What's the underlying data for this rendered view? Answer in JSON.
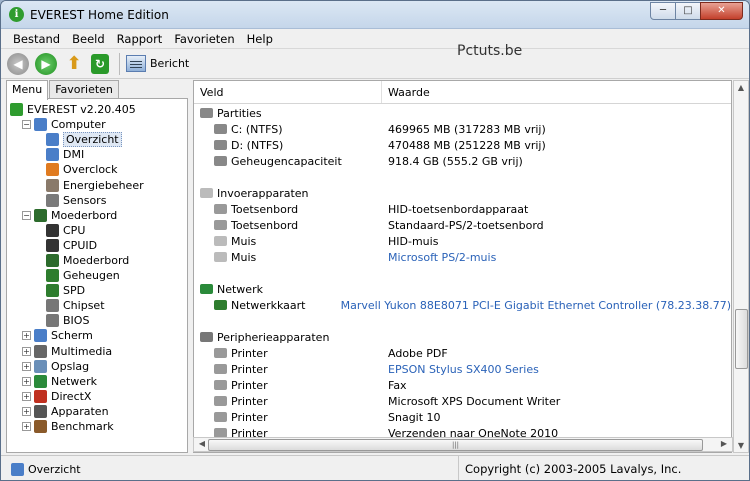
{
  "window": {
    "title": "EVEREST Home Edition",
    "min": "─",
    "max": "□",
    "close": "✕"
  },
  "menu": [
    "Bestand",
    "Beeld",
    "Rapport",
    "Favorieten",
    "Help"
  ],
  "toolbar": {
    "report_label": "Bericht",
    "watermark": "Pctuts.be"
  },
  "left_tabs": [
    "Menu",
    "Favorieten"
  ],
  "tree": [
    {
      "indent": 0,
      "exp": "",
      "label": "EVEREST v2.20.405",
      "icon": "info-icon",
      "color": "#2f9c2f"
    },
    {
      "indent": 1,
      "exp": "−",
      "label": "Computer",
      "icon": "computer-icon",
      "color": "#4a7ec8"
    },
    {
      "indent": 2,
      "exp": "",
      "label": "Overzicht",
      "icon": "computer-icon",
      "color": "#4a7ec8",
      "selected": true
    },
    {
      "indent": 2,
      "exp": "",
      "label": "DMI",
      "icon": "computer-icon",
      "color": "#4a7ec8"
    },
    {
      "indent": 2,
      "exp": "",
      "label": "Overclock",
      "icon": "fire-icon",
      "color": "#e07b20"
    },
    {
      "indent": 2,
      "exp": "",
      "label": "Energiebeheer",
      "icon": "power-icon",
      "color": "#8a7a6a"
    },
    {
      "indent": 2,
      "exp": "",
      "label": "Sensors",
      "icon": "sensor-icon",
      "color": "#7a7a7a"
    },
    {
      "indent": 1,
      "exp": "−",
      "label": "Moederbord",
      "icon": "motherboard-icon",
      "color": "#2c6b2c"
    },
    {
      "indent": 2,
      "exp": "",
      "label": "CPU",
      "icon": "cpu-icon",
      "color": "#333"
    },
    {
      "indent": 2,
      "exp": "",
      "label": "CPUID",
      "icon": "cpu-icon",
      "color": "#333"
    },
    {
      "indent": 2,
      "exp": "",
      "label": "Moederbord",
      "icon": "motherboard-icon",
      "color": "#2c6b2c"
    },
    {
      "indent": 2,
      "exp": "",
      "label": "Geheugen",
      "icon": "memory-icon",
      "color": "#2e7d2e"
    },
    {
      "indent": 2,
      "exp": "",
      "label": "SPD",
      "icon": "memory-icon",
      "color": "#2e7d2e"
    },
    {
      "indent": 2,
      "exp": "",
      "label": "Chipset",
      "icon": "chip-icon",
      "color": "#777"
    },
    {
      "indent": 2,
      "exp": "",
      "label": "BIOS",
      "icon": "chip-icon",
      "color": "#777"
    },
    {
      "indent": 1,
      "exp": "+",
      "label": "Scherm",
      "icon": "monitor-icon",
      "color": "#4a7ec8"
    },
    {
      "indent": 1,
      "exp": "+",
      "label": "Multimedia",
      "icon": "multimedia-icon",
      "color": "#666"
    },
    {
      "indent": 1,
      "exp": "+",
      "label": "Opslag",
      "icon": "storage-icon",
      "color": "#6a8fb8"
    },
    {
      "indent": 1,
      "exp": "+",
      "label": "Netwerk",
      "icon": "network-icon",
      "color": "#2a8a3a"
    },
    {
      "indent": 1,
      "exp": "+",
      "label": "DirectX",
      "icon": "directx-icon",
      "color": "#c03020"
    },
    {
      "indent": 1,
      "exp": "+",
      "label": "Apparaten",
      "icon": "devices-icon",
      "color": "#555"
    },
    {
      "indent": 1,
      "exp": "+",
      "label": "Benchmark",
      "icon": "hourglass-icon",
      "color": "#8a5a2a"
    }
  ],
  "columns": {
    "field": "Veld",
    "value": "Waarde"
  },
  "rows": [
    {
      "f": "Partities",
      "v": "",
      "cat": true,
      "icon": "drive-icon",
      "color": "#888"
    },
    {
      "f": "C: (NTFS)",
      "v": "469965 MB (317283 MB vrij)",
      "icon": "drive-icon",
      "color": "#888"
    },
    {
      "f": "D: (NTFS)",
      "v": "470488 MB (251228 MB vrij)",
      "icon": "drive-icon",
      "color": "#888"
    },
    {
      "f": "Geheugencapaciteit",
      "v": "918.4 GB (555.2 GB vrij)",
      "icon": "drive-icon",
      "color": "#888"
    },
    {
      "f": "",
      "v": ""
    },
    {
      "f": "Invoerapparaten",
      "v": "",
      "cat": true,
      "icon": "mouse-icon",
      "color": "#bbb"
    },
    {
      "f": "Toetsenbord",
      "v": "HID-toetsenbordapparaat",
      "icon": "keyboard-icon",
      "color": "#999"
    },
    {
      "f": "Toetsenbord",
      "v": "Standaard-PS/2-toetsenbord",
      "icon": "keyboard-icon",
      "color": "#999"
    },
    {
      "f": "Muis",
      "v": "HID-muis",
      "icon": "mouse-icon",
      "color": "#bbb"
    },
    {
      "f": "Muis",
      "v": "Microsoft PS/2-muis",
      "link": true,
      "icon": "mouse-icon",
      "color": "#bbb"
    },
    {
      "f": "",
      "v": ""
    },
    {
      "f": "Netwerk",
      "v": "",
      "cat": true,
      "icon": "network-icon",
      "color": "#2a8a3a"
    },
    {
      "f": "Netwerkkaart",
      "v": "Marvell Yukon 88E8071 PCI-E Gigabit Ethernet Controller  (78.23.38.77)",
      "link": true,
      "icon": "network-card-icon",
      "color": "#2e7d2e"
    },
    {
      "f": "",
      "v": ""
    },
    {
      "f": "Peripherieapparaten",
      "v": "",
      "cat": true,
      "icon": "devices-icon",
      "color": "#777"
    },
    {
      "f": "Printer",
      "v": "Adobe PDF",
      "icon": "printer-icon",
      "color": "#999"
    },
    {
      "f": "Printer",
      "v": "EPSON Stylus SX400 Series",
      "link": true,
      "icon": "printer-icon",
      "color": "#999"
    },
    {
      "f": "Printer",
      "v": "Fax",
      "icon": "printer-icon",
      "color": "#999"
    },
    {
      "f": "Printer",
      "v": "Microsoft XPS Document Writer",
      "icon": "printer-icon",
      "color": "#999"
    },
    {
      "f": "Printer",
      "v": "Snagit 10",
      "icon": "printer-icon",
      "color": "#999"
    },
    {
      "f": "Printer",
      "v": "Verzenden naar OneNote 2010",
      "icon": "printer-icon",
      "color": "#999"
    }
  ],
  "status": {
    "left": "Overzicht",
    "right": "Copyright (c) 2003-2005 Lavalys, Inc."
  }
}
